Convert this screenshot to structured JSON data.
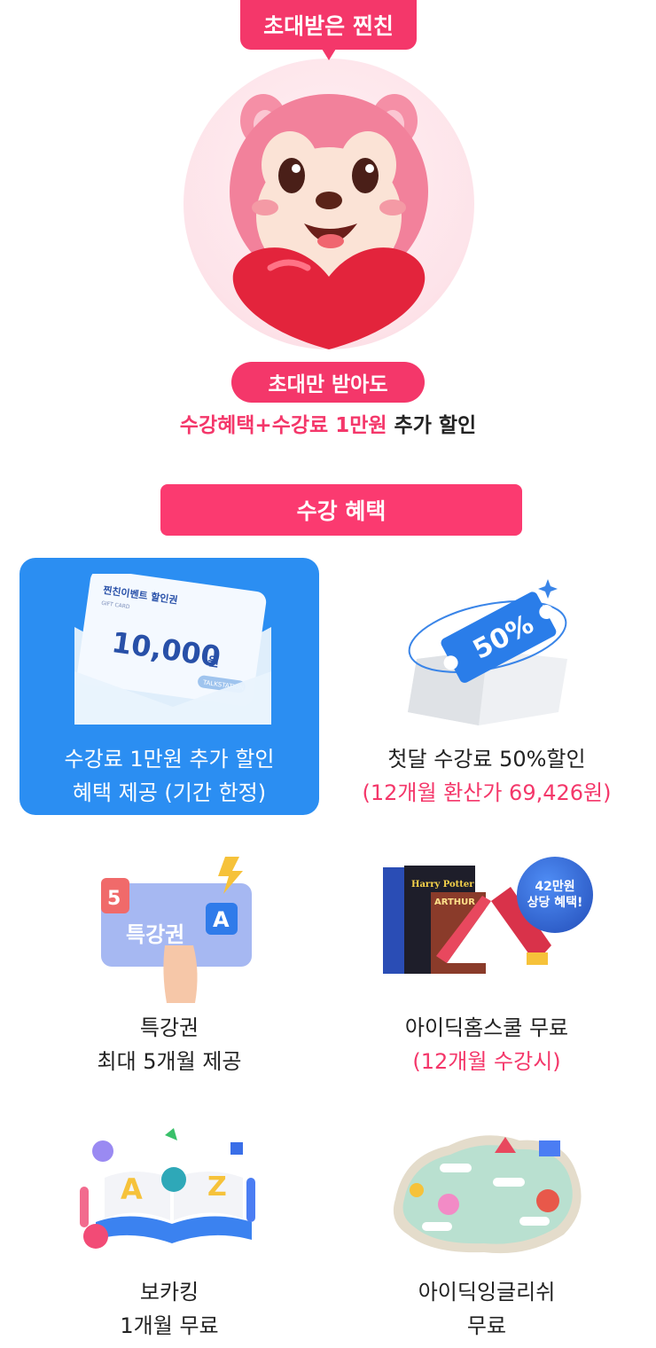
{
  "header": {
    "badge_label": "초대받은 찐친",
    "sub_pill": "초대만 받아도",
    "line_pink": "수강혜택+수강료 1만원",
    "line_black": " 추가 할인"
  },
  "section": {
    "title": "수강 혜택"
  },
  "coupon": {
    "brand": "찐친이벤트 할인권",
    "small": "GIFT CARD",
    "amount": "10,000",
    "unit": "원",
    "tag": "TALKSTATION"
  },
  "ticket": {
    "text": "50%"
  },
  "lecture": {
    "num": "5",
    "text": "특강권",
    "letter": "A"
  },
  "book": {
    "chip_line1": "42만원",
    "chip_line2": "상당 혜택!",
    "title1": "Harry Potter",
    "title2": "ARTHUR"
  },
  "benefits": [
    {
      "lines": [
        "수강료 1만원 추가 할인",
        "혜택 제공 (기간 한정)"
      ],
      "pink": []
    },
    {
      "lines": [
        "첫달 수강료 50%할인"
      ],
      "pink": [
        "(12개월 환산가 69,426원)"
      ]
    },
    {
      "lines": [
        "특강권",
        "최대 5개월 제공"
      ],
      "pink": []
    },
    {
      "lines": [
        "아이딕홈스쿨 무료"
      ],
      "pink": [
        "(12개월 수강시)"
      ]
    },
    {
      "lines": [
        "보카킹",
        "1개월 무료"
      ],
      "pink": []
    },
    {
      "lines": [
        "아이딕잉글리쉬",
        "무료"
      ],
      "pink": []
    }
  ],
  "colors": {
    "pink": "#f4376a",
    "blue": "#2b8ef2",
    "section": "#fb3a70"
  }
}
